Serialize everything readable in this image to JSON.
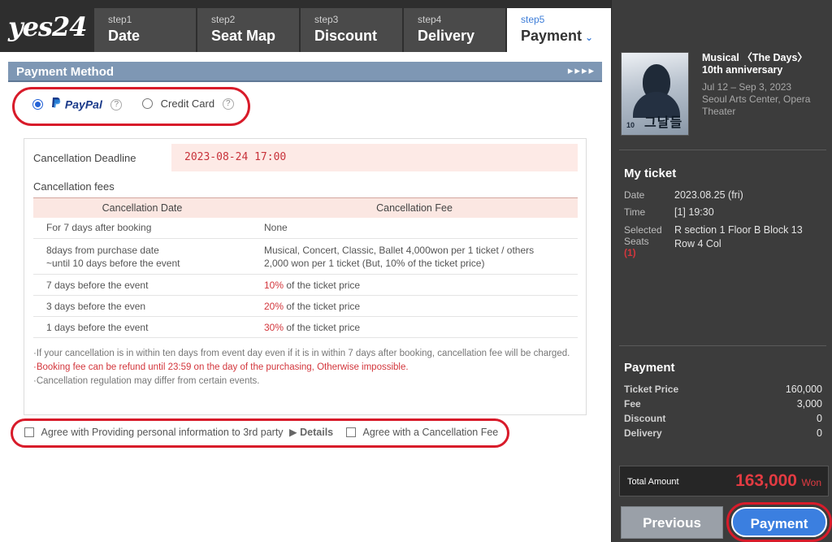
{
  "brand": {
    "logo_text": "yes24"
  },
  "steps": [
    {
      "num": "step1",
      "label": "Date"
    },
    {
      "num": "step2",
      "label": "Seat Map"
    },
    {
      "num": "step3",
      "label": "Discount"
    },
    {
      "num": "step4",
      "label": "Delivery"
    },
    {
      "num": "step5",
      "label": "Payment",
      "active": true
    }
  ],
  "payment_method": {
    "title": "Payment Method",
    "arrows": "▸▸▸▸",
    "options": [
      {
        "label": "PayPal",
        "selected": true
      },
      {
        "label": "Credit Card",
        "selected": false
      }
    ],
    "help_glyph": "?"
  },
  "cancellation": {
    "deadline_label": "Cancellation Deadline",
    "deadline_value": "2023-08-24 17:00",
    "fees_title": "Cancellation fees",
    "headers": [
      "Cancellation Date",
      "Cancellation Fee"
    ],
    "rows": [
      {
        "date": "For 7 days after booking",
        "fee": "None"
      },
      {
        "date_line1": "8days from purchase date",
        "date_line2": "~until 10 days before the event",
        "fee_line1": "Musical, Concert, Classic, Ballet 4,000won per 1 ticket / others",
        "fee_line2": "2,000 won per 1 ticket (But, 10% of the ticket price)"
      },
      {
        "date": "7 days before the event",
        "pct": "10%",
        "rest": " of the ticket price"
      },
      {
        "date": "3 days before the even",
        "pct": "20%",
        "rest": " of the ticket price"
      },
      {
        "date": "1 days before the event",
        "pct": "30%",
        "rest": " of the ticket price"
      }
    ],
    "notes": [
      "·If your cancellation is in within ten days from event day even if it is in within 7 days after booking, cancellation fee will be charged.",
      "·Booking fee can be refund until 23:59 on the day of the purchasing, Otherwise impossible.",
      "·Cancellation regulation may differ from certain events."
    ]
  },
  "agreements": {
    "third_party": "Agree with Providing personal information to 3rd party",
    "details": "▶ Details",
    "cancel_fee": "Agree with a Cancellation Fee"
  },
  "show": {
    "title": "Musical 〈The Days〉 10th anniversary",
    "dates": "Jul 12 – Sep 3, 2023",
    "venue": "Seoul Arts Center, Opera Theater",
    "poster_mark": "10",
    "poster_korean": "그날들"
  },
  "ticket": {
    "title": "My ticket",
    "date_label": "Date",
    "date_value": "2023.08.25 (fri)",
    "time_label": "Time",
    "time_value": "[1] 19:30",
    "seats_label_1": "Selected",
    "seats_label_2": "Seats",
    "seats_count": "(1)",
    "seats_value": "R section 1 Floor B Block 13 Row 4 Col"
  },
  "payment_summary": {
    "title": "Payment",
    "ticket_price_label": "Ticket Price",
    "ticket_price": "160,000",
    "fee_label": "Fee",
    "fee": "3,000",
    "discount_label": "Discount",
    "discount": "0",
    "delivery_label": "Delivery",
    "delivery": "0",
    "total_label": "Total Amount",
    "total": "163,000",
    "currency": "Won"
  },
  "buttons": {
    "previous": "Previous",
    "payment": "Payment"
  },
  "colors": {
    "accent_blue": "#3b7fe0",
    "highlight_red": "#d81b2a",
    "sidebar_bg": "#3c3c3c"
  }
}
